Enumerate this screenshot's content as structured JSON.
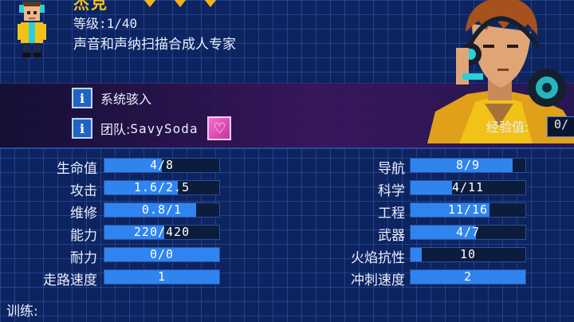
{
  "character": {
    "name": "杰克",
    "level": "等级:1/40",
    "title": "声音和声纳扫描合成人专家"
  },
  "info": {
    "entry": "系统骇入",
    "team_prefix": "团队: ",
    "team_name": "SavySoda"
  },
  "xp": {
    "label": "经验值:",
    "value": "0/"
  },
  "stats_left": [
    {
      "label": "生命值",
      "value": "4/8",
      "fill": 0.5
    },
    {
      "label": "攻击",
      "value": "1.6/2.5",
      "fill": 0.64
    },
    {
      "label": "维修",
      "value": "0.8/1",
      "fill": 0.8
    },
    {
      "label": "能力",
      "value": "220/420",
      "fill": 0.52
    },
    {
      "label": "耐力",
      "value": "0/0",
      "fill": 1.0
    },
    {
      "label": "走路速度",
      "value": "1",
      "fill": 1.0
    }
  ],
  "stats_right": [
    {
      "label": "导航",
      "value": "8/9",
      "fill": 0.89
    },
    {
      "label": "科学",
      "value": "4/11",
      "fill": 0.36
    },
    {
      "label": "工程",
      "value": "11/16",
      "fill": 0.69
    },
    {
      "label": "武器",
      "value": "4/7",
      "fill": 0.57
    },
    {
      "label": "火焰抗性",
      "value": "10",
      "fill": 0.1
    },
    {
      "label": "冲刺速度",
      "value": "2",
      "fill": 1.0
    }
  ],
  "training_label": "训练:",
  "colors": {
    "bar_fill": "#2f84f0",
    "bar_empty": "#0c1c3c",
    "name_gold": "#f4c21a",
    "background": "#0d2461"
  },
  "icons": {
    "info": "info-icon",
    "team": "heart-badge-icon"
  }
}
